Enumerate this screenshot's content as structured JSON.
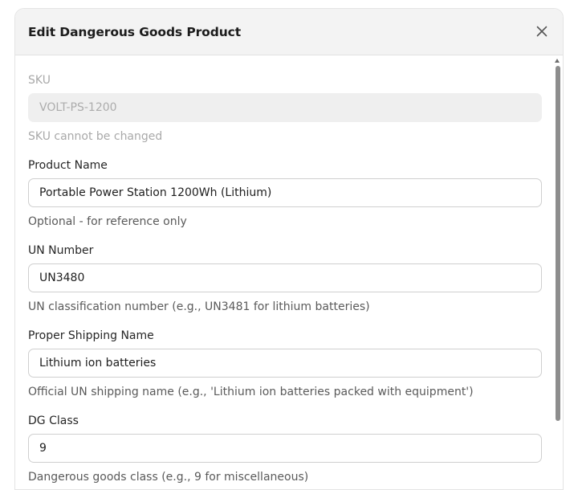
{
  "modal": {
    "title": "Edit Dangerous Goods Product",
    "close_icon": "close-icon"
  },
  "fields": {
    "sku": {
      "label": "SKU",
      "value": "VOLT-PS-1200",
      "help": "SKU cannot be changed",
      "disabled": true
    },
    "product_name": {
      "label": "Product Name",
      "value": "Portable Power Station 1200Wh (Lithium)",
      "help": "Optional - for reference only"
    },
    "un_number": {
      "label": "UN Number",
      "value": "UN3480",
      "help": "UN classification number (e.g., UN3481 for lithium batteries)"
    },
    "proper_shipping_name": {
      "label": "Proper Shipping Name",
      "value": "Lithium ion batteries",
      "help": "Official UN shipping name (e.g., 'Lithium ion batteries packed with equipment')"
    },
    "dg_class": {
      "label": "DG Class",
      "value": "9",
      "help": "Dangerous goods class (e.g., 9 for miscellaneous)"
    }
  },
  "colors": {
    "header_bg": "#f3f3f3",
    "disabled_text": "#a9a9a9",
    "input_border": "#cfcfcf",
    "scrollbar_thumb": "#8d8d8d"
  }
}
